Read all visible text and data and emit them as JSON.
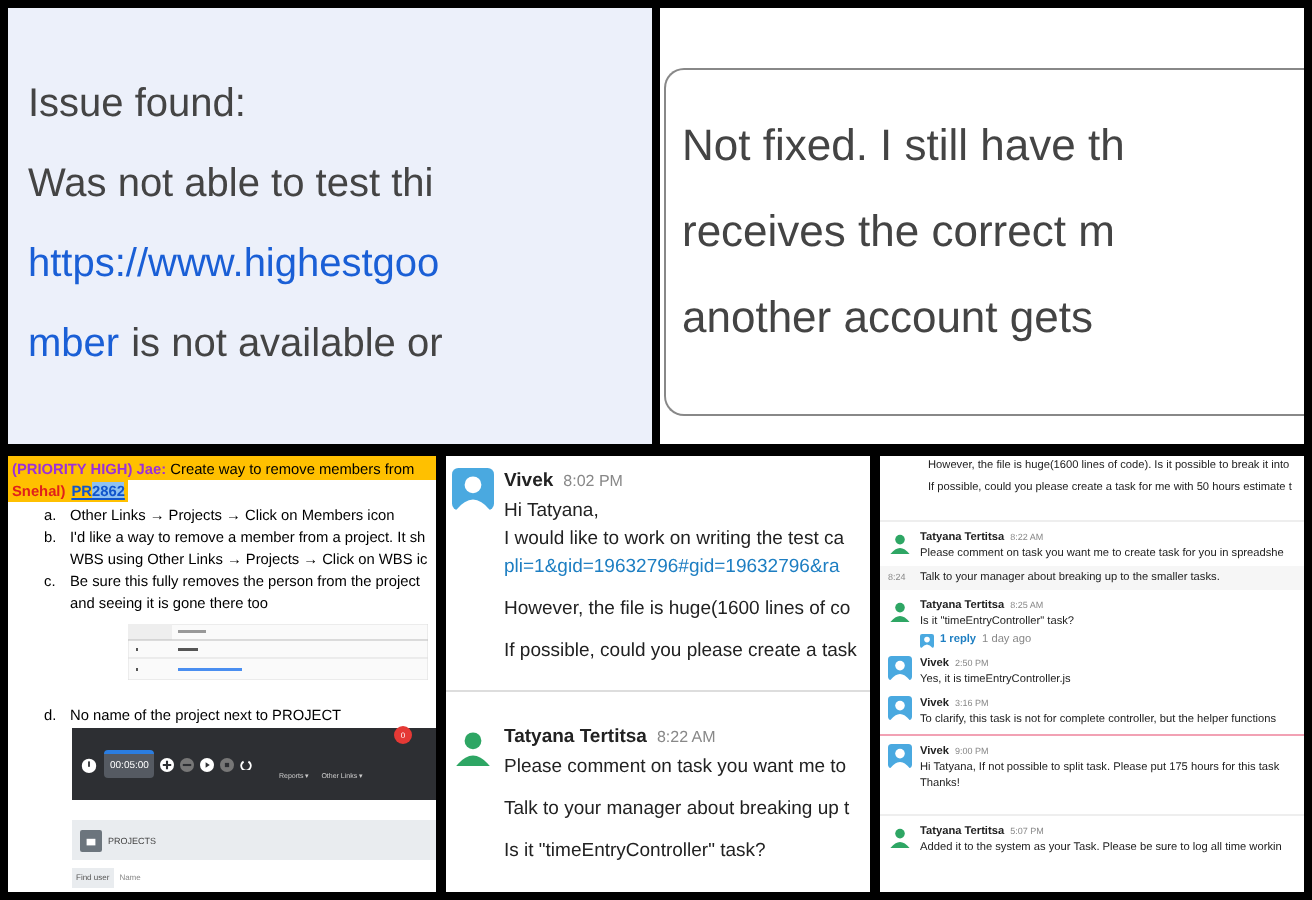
{
  "issue_note": {
    "heading": "Issue found:",
    "line": "Was not able to test thi",
    "link": "https://www.highestgoo",
    "link_tail": "mber",
    "rest": "is not available or"
  },
  "comment_box": {
    "lines": [
      "Not fixed. I still have th",
      "receives the correct m",
      "another account gets"
    ]
  },
  "task_doc": {
    "priority": "(PRIORITY HIGH)",
    "assignee": "Jae:",
    "title": "Create way to remove members from",
    "owner": "Snehal)",
    "pr_label": "PR",
    "pr_number": "2862",
    "items": [
      {
        "marker": "a.",
        "lines": [
          "Other Links → Projects → Click on Members icon"
        ]
      },
      {
        "marker": "b.",
        "lines": [
          "I'd like a way to remove a member from a project. It sh",
          "WBS using Other Links → Projects → Click on WBS ic"
        ]
      },
      {
        "marker": "c.",
        "lines": [
          "Be sure this fully removes the person from the project",
          "and seeing it is gone there too"
        ]
      }
    ],
    "item_d": {
      "marker": "d.",
      "text": "No name of the project next to PROJECT"
    },
    "app_bar": {
      "timer": "00:05:00",
      "badge": "0",
      "menus": [
        "Reports ▾",
        "Other Links ▾"
      ]
    },
    "projects_header": "PROJECTS",
    "find_user": "Find user",
    "name_placeholder": "Name"
  },
  "chat_zoom": {
    "messages": [
      {
        "author": "Vivek",
        "time": "8:02 PM",
        "avatar": {
          "kind": "tile",
          "color": "#4aa9e0"
        },
        "lines": [
          "Hi Tatyana,",
          "I would like to work on writing the test ca"
        ],
        "link": "pli=1&gid=19632796#gid=19632796&ra",
        "after": [
          "However, the file is huge(1600 lines of co",
          "If possible, could you please create a task"
        ]
      },
      {
        "author": "Tatyana Tertitsa",
        "time": "8:22 AM",
        "avatar": {
          "kind": "figure",
          "color": "#2ea664"
        },
        "lines": [
          "Please comment on task you want me to",
          "Talk to your manager about breaking up t",
          "Is it \"timeEntryController\" task?"
        ]
      }
    ]
  },
  "chat_thread": {
    "top_lines": [
      "However, the file is huge(1600 lines of code). Is it possible to break it into",
      "If possible, could you please create a task for me with 50 hours estimate t"
    ],
    "messages": [
      {
        "author": "Tatyana Tertitsa",
        "time": "8:22 AM",
        "avatar": {
          "kind": "figure",
          "color": "#2ea664"
        },
        "lines": [
          "Please comment on task you want me to create task for you in spreadshe"
        ],
        "followup": {
          "time": "8:24",
          "text": "Talk to your manager about breaking up to the smaller tasks."
        }
      },
      {
        "author": "Tatyana Tertitsa",
        "time": "8:25 AM",
        "avatar": {
          "kind": "figure",
          "color": "#2ea664"
        },
        "lines": [
          "Is it \"timeEntryController\" task?"
        ],
        "reply": {
          "count": "1 reply",
          "age": "1 day ago"
        }
      },
      {
        "author": "Vivek",
        "time": "2:50 PM",
        "avatar": {
          "kind": "tile",
          "color": "#4aa9e0"
        },
        "lines": [
          "Yes, it is timeEntryController.js"
        ]
      },
      {
        "author": "Vivek",
        "time": "3:16 PM",
        "avatar": {
          "kind": "tile",
          "color": "#4aa9e0"
        },
        "lines": [
          "To clarify, this task is not for complete controller, but the helper functions"
        ],
        "new_divider": true
      },
      {
        "author": "Vivek",
        "time": "9:00 PM",
        "avatar": {
          "kind": "tile",
          "color": "#4aa9e0"
        },
        "lines": [
          "Hi Tatyana, If not possible to split task. Please put 175 hours for this task",
          "Thanks!"
        ]
      },
      {
        "author": "Tatyana Tertitsa",
        "time": "5:07 PM",
        "avatar": {
          "kind": "figure",
          "color": "#2ea664"
        },
        "lines": [
          "Added it to the system as your Task. Please be sure to log all time workin"
        ],
        "gap": true
      }
    ]
  }
}
